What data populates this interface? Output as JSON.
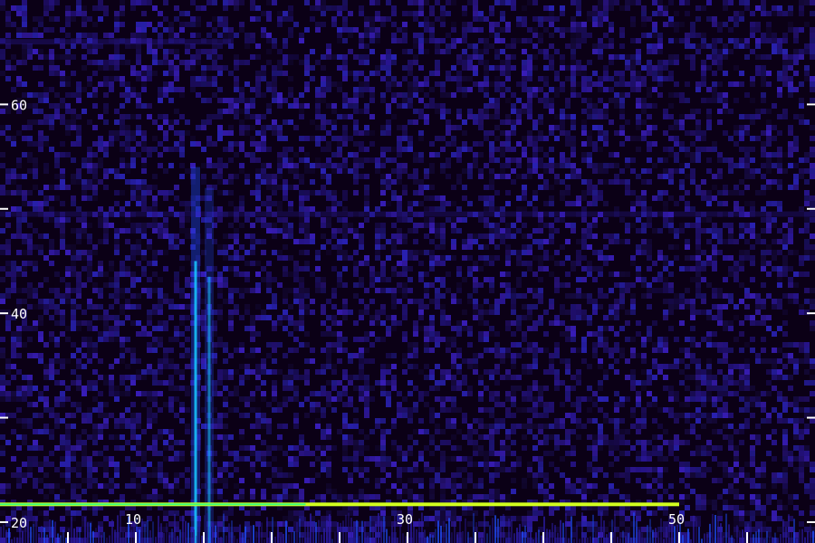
{
  "chart_data": {
    "type": "heatmap",
    "title": "",
    "xlabel": "",
    "ylabel": "",
    "x_range": [
      0,
      60
    ],
    "y_range": [
      18,
      70
    ],
    "x_tick_labels": [
      {
        "value": 10,
        "label": "10"
      },
      {
        "value": 30,
        "label": "30"
      },
      {
        "value": 50,
        "label": "50"
      }
    ],
    "x_ticks_minor": [
      5,
      10,
      15,
      20,
      25,
      30,
      35,
      40,
      45,
      50,
      55
    ],
    "y_tick_labels": [
      {
        "value": 20,
        "label": "20"
      },
      {
        "value": 40,
        "label": "40"
      },
      {
        "value": 60,
        "label": "60"
      }
    ],
    "y_ticks": [
      20,
      30,
      40,
      50,
      60
    ],
    "features": [
      {
        "kind": "vertical-streak",
        "x": 14.4,
        "y_from": 18,
        "y_to": 54,
        "intensity": 0.85
      },
      {
        "kind": "vertical-streak",
        "x": 15.4,
        "y_from": 18,
        "y_to": 52,
        "intensity": 0.55
      },
      {
        "kind": "horizontal-line",
        "y": 21.7,
        "x_from": 0,
        "x_to": 50,
        "intensity": 1.0
      },
      {
        "kind": "horizontal-band",
        "y": 66,
        "x_from": 0,
        "x_to": 17,
        "intensity": 0.35
      },
      {
        "kind": "horizontal-band",
        "y": 49.5,
        "x_from": 0,
        "x_to": 60,
        "intensity": 0.3
      }
    ],
    "colormap": [
      "#0b0016",
      "#1a0a5a",
      "#2a1aa0",
      "#1f4fff",
      "#19c8ff",
      "#3cff7a",
      "#d2ff1e"
    ],
    "grid": false,
    "legend": "none"
  }
}
